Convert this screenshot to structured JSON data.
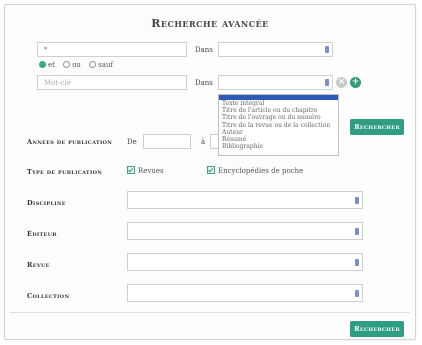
{
  "form": {
    "title": "Recherche avancée",
    "row1": {
      "query_value": "*",
      "dans_label": "Dans"
    },
    "operators": [
      "et",
      "ou",
      "sauf"
    ],
    "row2": {
      "query_placeholder": "Mot-clé",
      "dans_label": "Dans"
    },
    "field_options": [
      "Texte intégral",
      "Titre de l'article ou du chapitre",
      "Titre de l'ouvrage ou du numéro",
      "Titre de la revue ou de la collection",
      "Auteur",
      "Résumé",
      "Bibliographie"
    ],
    "search_button": "Rechercher",
    "years": {
      "label": "Années de publication",
      "from_label": "De",
      "to_label": "à"
    },
    "pub_type": {
      "label": "Type de publication",
      "options": [
        "Revues",
        "Encyclopédies de poche"
      ]
    },
    "discipline_label": "Discipline",
    "editeur_label": "Éditeur",
    "revue_label": "Revue",
    "collection_label": "Collection",
    "search_button_bottom": "Rechercher"
  },
  "colors": {
    "accent": "#2f9e80",
    "select_arrow": "#7a8fd1",
    "dropdown_highlight": "#2f59b8"
  }
}
